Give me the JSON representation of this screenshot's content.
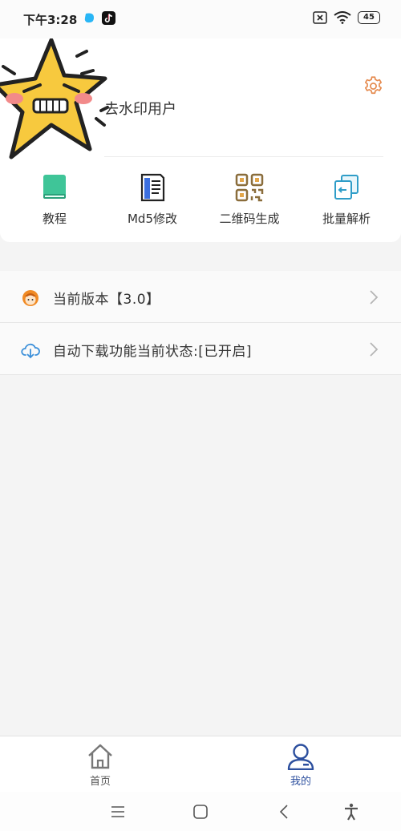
{
  "status_bar": {
    "time": "下午3:28",
    "battery": "45"
  },
  "profile": {
    "username": "去水印用户"
  },
  "quick_actions": [
    {
      "label": "教程",
      "icon": "book-icon"
    },
    {
      "label": "Md5修改",
      "icon": "document-icon"
    },
    {
      "label": "二维码生成",
      "icon": "qr-code-icon"
    },
    {
      "label": "批量解析",
      "icon": "batch-parse-icon"
    }
  ],
  "menu": [
    {
      "label": "当前版本【3.0】",
      "icon": "version-avatar-icon"
    },
    {
      "label": "自动下载功能当前状态:[已开启]",
      "icon": "cloud-download-icon"
    }
  ],
  "tabs": [
    {
      "label": "首页",
      "icon": "home-icon",
      "active": false
    },
    {
      "label": "我的",
      "icon": "user-icon",
      "active": true
    }
  ],
  "colors": {
    "accent": "#2c4f9e",
    "settings": "#e58a4e",
    "inactive": "#666666"
  }
}
